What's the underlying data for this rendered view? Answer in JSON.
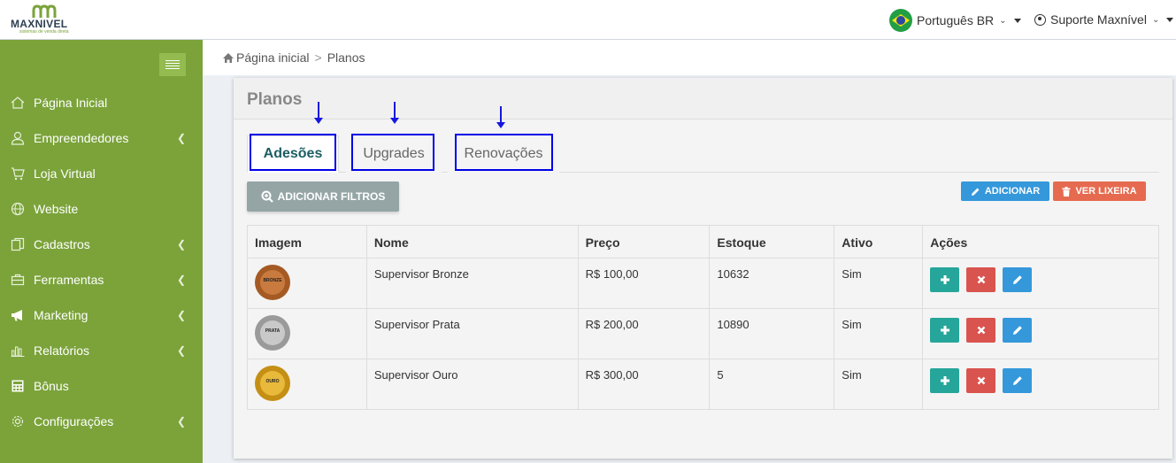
{
  "header": {
    "logo_text": "MAXNIVEL",
    "logo_tagline": "sistemas de venda direta",
    "language_label": "Português BR",
    "user_label": "Suporte Maxnível"
  },
  "sidebar": {
    "items": [
      {
        "label": "Página Inicial",
        "icon": "home-icon",
        "has_submenu": false
      },
      {
        "label": "Empreendedores",
        "icon": "user-icon",
        "has_submenu": true
      },
      {
        "label": "Loja Virtual",
        "icon": "cart-icon",
        "has_submenu": false
      },
      {
        "label": "Website",
        "icon": "globe-icon",
        "has_submenu": false
      },
      {
        "label": "Cadastros",
        "icon": "copy-icon",
        "has_submenu": true
      },
      {
        "label": "Ferramentas",
        "icon": "briefcase-icon",
        "has_submenu": true
      },
      {
        "label": "Marketing",
        "icon": "megaphone-icon",
        "has_submenu": true
      },
      {
        "label": "Relatórios",
        "icon": "bar-chart-icon",
        "has_submenu": true
      },
      {
        "label": "Bônus",
        "icon": "calculator-icon",
        "has_submenu": false
      },
      {
        "label": "Configurações",
        "icon": "gear-icon",
        "has_submenu": true
      }
    ]
  },
  "breadcrumb": {
    "home": "Página inicial",
    "separator": ">",
    "current": "Planos"
  },
  "panel": {
    "title": "Planos",
    "tabs": [
      {
        "label": "Adesões",
        "active": true
      },
      {
        "label": "Upgrades",
        "active": false
      },
      {
        "label": "Renovações",
        "active": false
      }
    ],
    "buttons": {
      "filter": "ADICIONAR FILTROS",
      "add": "ADICIONAR",
      "trash": "VER LIXEIRA"
    }
  },
  "table": {
    "columns": [
      "Imagem",
      "Nome",
      "Preço",
      "Estoque",
      "Ativo",
      "Ações"
    ],
    "rows": [
      {
        "badge": "BRONZE",
        "badge_color": "#b5652b",
        "name": "Supervisor Bronze",
        "price": "R$ 100,00",
        "stock": "10632",
        "active": "Sim"
      },
      {
        "badge": "PRATA",
        "badge_color": "#a8a8a8",
        "name": "Supervisor Prata",
        "price": "R$ 200,00",
        "stock": "10890",
        "active": "Sim"
      },
      {
        "badge": "OURO",
        "badge_color": "#d9a520",
        "name": "Supervisor Ouro",
        "price": "R$ 300,00",
        "stock": "5",
        "active": "Sim"
      }
    ]
  },
  "colors": {
    "sidebar": "#7ba33a",
    "highlight": "#0000e8",
    "add_button": "#3498db",
    "trash_button": "#e66a4f",
    "plus_action": "#26a69a",
    "delete_action": "#d9534f"
  }
}
